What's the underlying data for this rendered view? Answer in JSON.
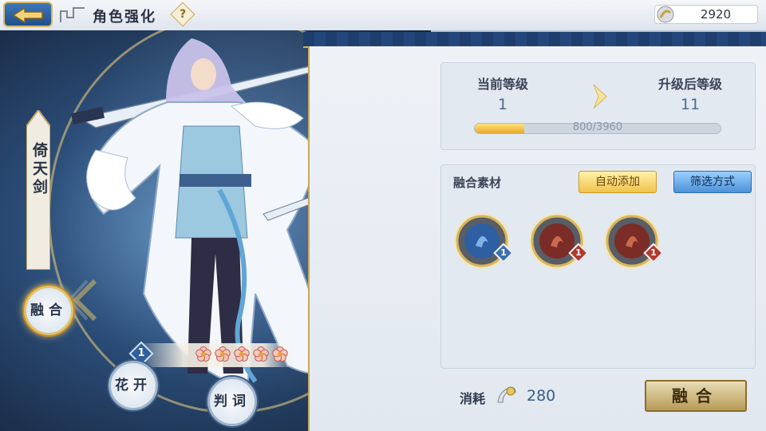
{
  "header": {
    "title": "角色强化",
    "help_glyph": "?",
    "currency": {
      "icon": "silver-coin-icon",
      "value": "2920"
    }
  },
  "character": {
    "weapon_name": "倚天剑",
    "rank": "1",
    "stars": 5,
    "star_icon": "plum-blossom-icon"
  },
  "side_buttons": {
    "fuse": "融合",
    "bloom": "花开",
    "verdict": "判词"
  },
  "level": {
    "current_label": "当前等级",
    "current_value": "1",
    "next_label": "升级后等级",
    "next_value": "11",
    "exp_text": "800/3960",
    "exp_progress": 0.2
  },
  "materials": {
    "title": "融合素材",
    "auto_add_label": "自动添加",
    "filter_label": "筛选方式",
    "items": [
      {
        "icon": "blue-water-orb-icon",
        "count": "1",
        "badge_color": "#3d6fae"
      },
      {
        "icon": "red-flame-orb-icon",
        "count": "1",
        "badge_color": "#b23a2c"
      },
      {
        "icon": "red-flame-orb-icon",
        "count": "1",
        "badge_color": "#b23a2c"
      }
    ]
  },
  "footer": {
    "cost_label": "消耗",
    "cost_icon": "silver-coin-icon",
    "cost_value": "280",
    "fuse_button": "融合"
  },
  "colors": {
    "accent_gold": "#d6b35d",
    "panel_bg": "#e3e9f1",
    "navy": "#1e3e6e"
  }
}
